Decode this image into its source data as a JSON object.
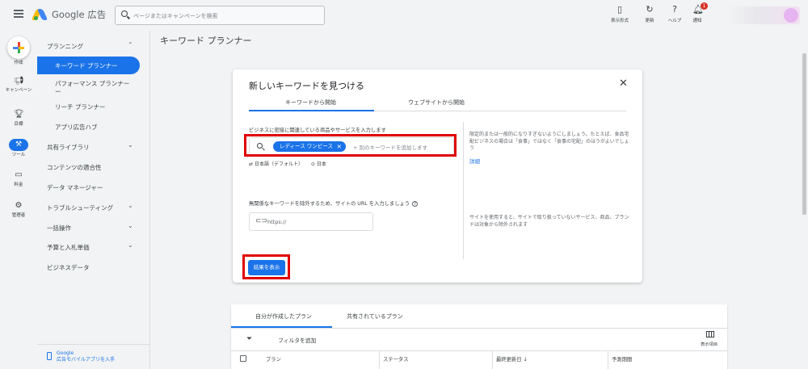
{
  "topbar": {
    "product_name": "Google 広告",
    "search_placeholder": "ページまたはキャンペーンを検索",
    "icons": [
      {
        "name": "appearance-icon",
        "label": "表示形式"
      },
      {
        "name": "refresh-icon",
        "label": "更新"
      },
      {
        "name": "help-icon",
        "label": "ヘルプ"
      },
      {
        "name": "notifications-icon",
        "label": "通知",
        "badge": "1"
      }
    ]
  },
  "rail": {
    "create_label": "作成",
    "items": [
      {
        "label": "キャンペーン",
        "icon": "megaphone-icon"
      },
      {
        "label": "目標",
        "icon": "trophy-icon"
      },
      {
        "label": "ツール",
        "icon": "tools-icon"
      },
      {
        "label": "料金",
        "icon": "billing-icon"
      },
      {
        "label": "管理者",
        "icon": "admin-gear-icon"
      }
    ]
  },
  "sidebar": {
    "planning_header": "プランニング",
    "keyword_planner": "キーワード プランナー",
    "performance_planner": "パフォーマンス プランナー",
    "performance_planner_cont": "ー",
    "reach_planner": "リーチ プランナー",
    "app_ad_hub": "アプリ広告ハブ",
    "shared_library": "共有ライブラリ",
    "content_suitability": "コンテンツの適合性",
    "data_manager": "データ マネージャー",
    "troubleshooting": "トラブルシューティング",
    "bulk_actions": "一括操作",
    "budgets_bidding": "予算と入札単価",
    "business_data": "ビジネスデータ",
    "footer_line1": "Google",
    "footer_line2": "広告モバイルアプリを入手"
  },
  "main": {
    "page_title": "キーワード プランナー"
  },
  "dialog": {
    "title": "新しいキーワードを見つける",
    "tab_keywords": "キーワードから開始",
    "tab_website": "ウェブサイトから開始",
    "product_field_label": "ビジネスに密接に関連している商品やサービスを入力します",
    "chip_keyword": "レディース ワンピース",
    "keyword_placeholder": "+ 別のキーワードを追加します",
    "language": "日本語（デフォルト）",
    "location": "日本",
    "hint_keywords": "限定的または一般的になりすぎないようにしましょう。たとえば、食品宅配ビジネスの場合は「食事」ではなく「食事の宅配」のほうがよいでしょう",
    "hint_details_link": "詳細",
    "url_field_label": "無関係なキーワードを除外するため、サイトの URL を入力しましょう",
    "url_placeholder": "https://",
    "hint_url": "サイトを使用すると、サイトで取り扱っていないサービス、商品、ブランドは対象から除外されます",
    "show_results_button": "結果を表示"
  },
  "plans": {
    "tab_my_plans": "自分が作成したプラン",
    "tab_shared_plans": "共有されているプラン",
    "add_filter": "フィルタを追加",
    "columns_label": "表示項目",
    "headers": [
      "プラン",
      "ステータス",
      "最終更新日",
      "予測期間"
    ],
    "sort_arrow": "↓"
  }
}
